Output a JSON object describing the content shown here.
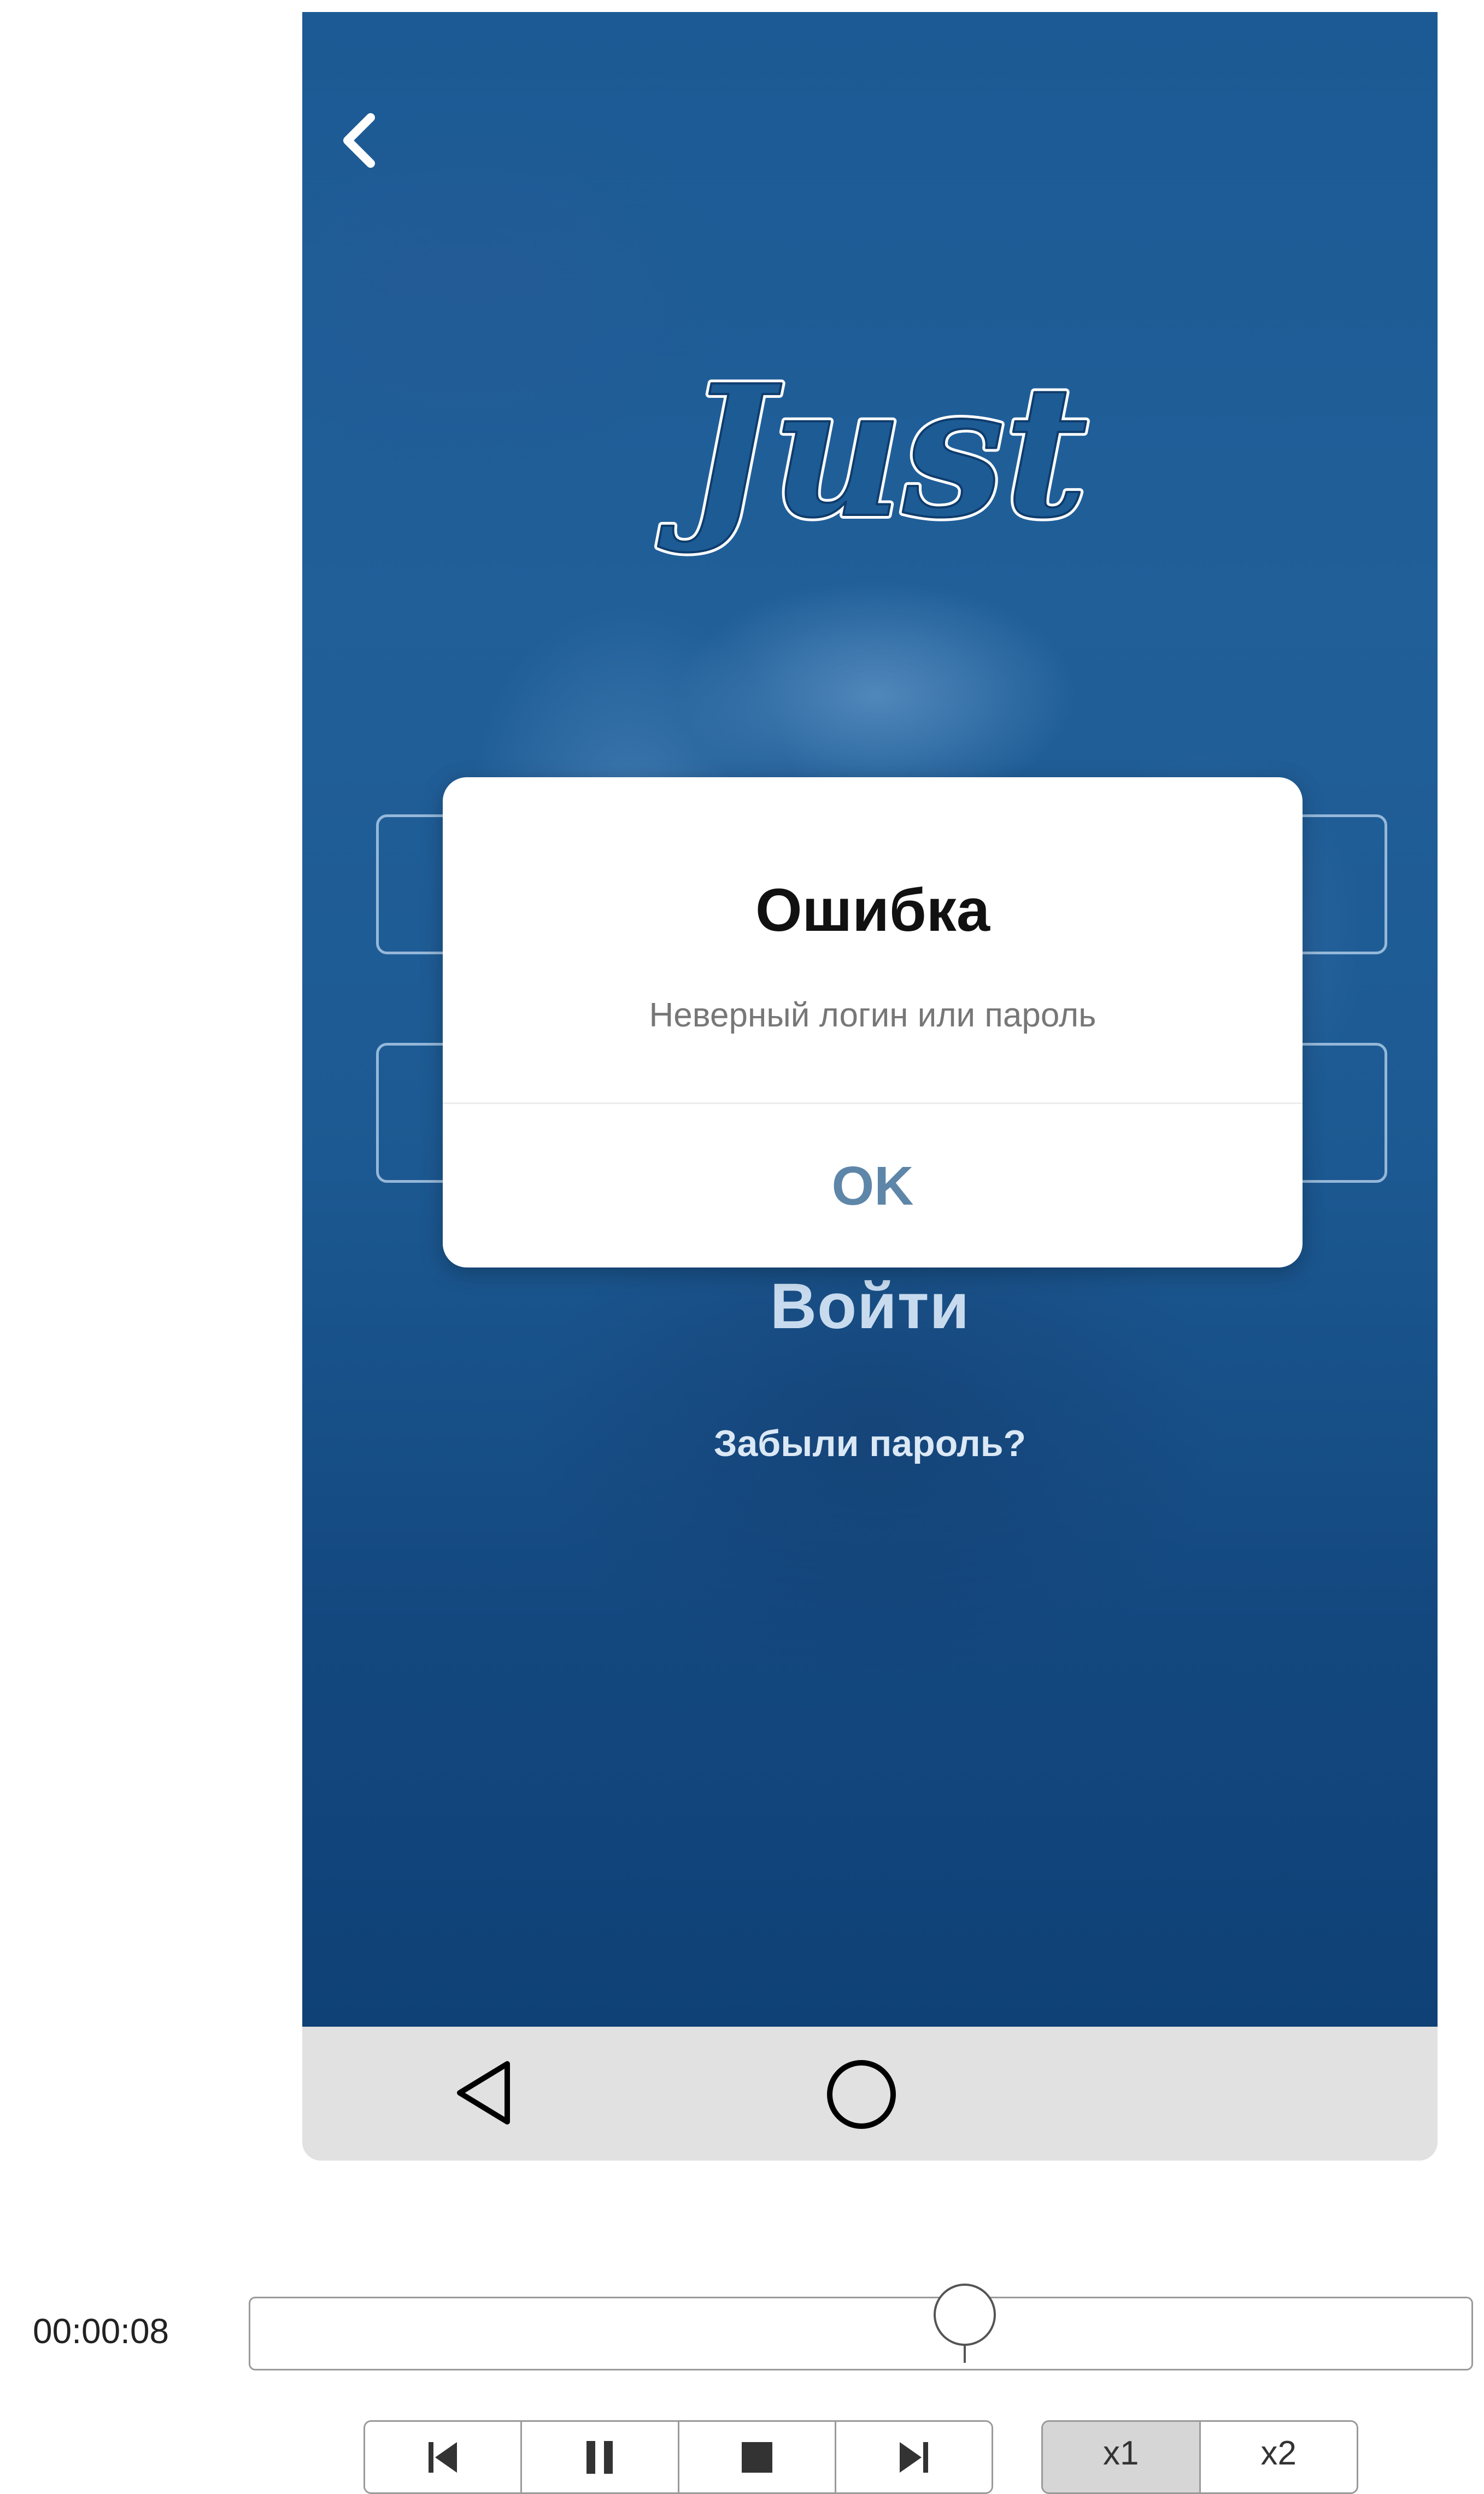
{
  "app": {
    "logo_text": "Just",
    "login_button_label": "Войти",
    "forgot_password_link": "Забыли пароль?"
  },
  "dialog": {
    "title": "Ошибка",
    "message": "Неверный логин или пароль",
    "ok_label": "OK"
  },
  "player": {
    "time": "00:00:08",
    "progress": 0.58,
    "speed_options": [
      "x1",
      "x2"
    ],
    "active_speed": "x1"
  },
  "colors": {
    "screen_blue": "#1b5a94",
    "dialog_button": "#5e86a8",
    "nav_bar": "#e1e1e1"
  }
}
